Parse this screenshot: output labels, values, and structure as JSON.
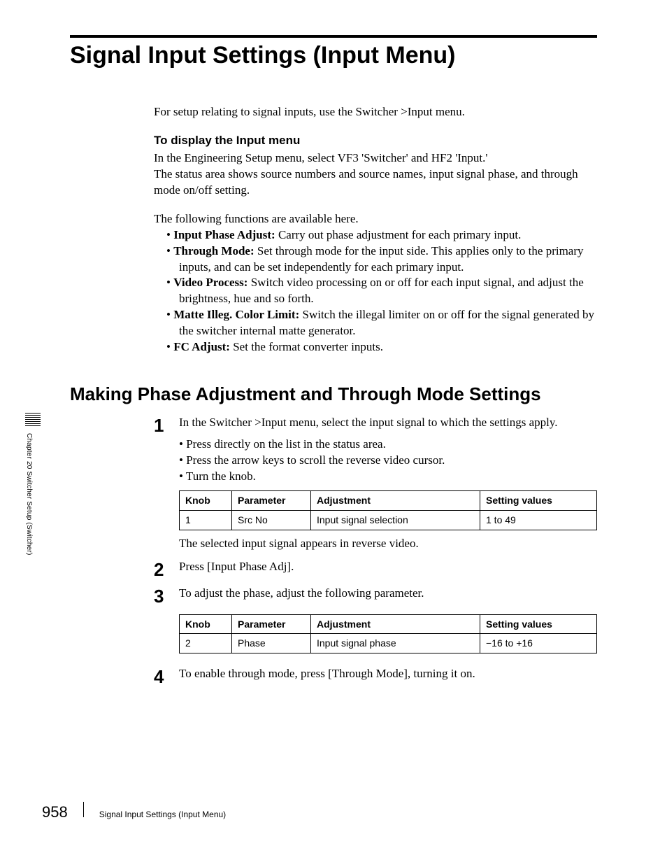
{
  "title": "Signal Input Settings (Input Menu)",
  "intro": "For setup relating to signal inputs, use the Switcher >Input menu.",
  "sub1_title": "To display the Input menu",
  "sub1_p1": "In the Engineering Setup menu, select VF3 'Switcher' and HF2 'Input.'",
  "sub1_p2": "The status area shows source numbers and source names, input signal phase, and through mode on/off setting.",
  "sub1_p3": "The following functions are available here.",
  "functions": [
    {
      "label": "Input Phase Adjust:",
      "text": " Carry out phase adjustment for each primary input."
    },
    {
      "label": "Through Mode:",
      "text": " Set through mode for the input side. This applies only to the primary inputs, and can be set independently for each primary input."
    },
    {
      "label": "Video Process:",
      "text": " Switch video processing on or off for each input signal, and adjust the brightness, hue and so forth."
    },
    {
      "label": "Matte Illeg. Color Limit:",
      "text": " Switch the illegal limiter on or off for the signal generated by the switcher internal matte generator."
    },
    {
      "label": "FC Adjust:",
      "text": " Set the format converter inputs."
    }
  ],
  "h2": "Making Phase Adjustment and Through Mode Settings",
  "steps": {
    "s1_text": "In the Switcher >Input menu, select the input signal to which the settings apply.",
    "s1_bullets": [
      "Press directly on the list in the status area.",
      "Press the arrow keys to scroll the reverse video cursor.",
      "Turn the knob."
    ],
    "s1_after": "The selected input signal appears in reverse video.",
    "s2_text": "Press [Input Phase Adj].",
    "s3_text": "To adjust the phase, adjust the following parameter.",
    "s4_text": "To enable through mode, press [Through Mode], turning it on."
  },
  "table_headers": {
    "knob": "Knob",
    "param": "Parameter",
    "adj": "Adjustment",
    "set": "Setting values"
  },
  "table1": {
    "knob": "1",
    "param": "Src No",
    "adj": "Input signal selection",
    "set": "1 to 49"
  },
  "table2": {
    "knob": "2",
    "param": "Phase",
    "adj": "Input signal phase",
    "set": "−16 to +16"
  },
  "sidecap": "Chapter 20  Switcher Setup (Switcher)",
  "footer": {
    "page": "958",
    "title": "Signal Input Settings (Input Menu)"
  },
  "chart_data": [
    {
      "type": "table",
      "headers": [
        "Knob",
        "Parameter",
        "Adjustment",
        "Setting values"
      ],
      "rows": [
        [
          "1",
          "Src No",
          "Input signal selection",
          "1 to 49"
        ]
      ]
    },
    {
      "type": "table",
      "headers": [
        "Knob",
        "Parameter",
        "Adjustment",
        "Setting values"
      ],
      "rows": [
        [
          "2",
          "Phase",
          "Input signal phase",
          "−16 to +16"
        ]
      ]
    }
  ]
}
